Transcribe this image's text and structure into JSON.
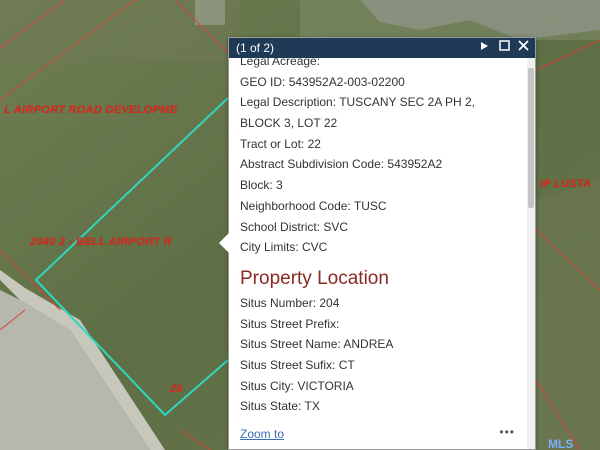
{
  "map": {
    "labels": {
      "road_top": "L AIRPORT ROAD DEVELOPME",
      "road_left": "2040   2 - BELL AIRPORT R",
      "road_bottom": "20 ",
      "right_edge": "IP LUSTA"
    },
    "colors": {
      "parcel_outline": "#2fd6c0",
      "lot_lines": "#d3453a",
      "label_red": "#e0261c"
    }
  },
  "popup": {
    "header": {
      "counter": "(1 of 2)",
      "next_icon": "play-icon",
      "maximize_icon": "maximize-icon",
      "close_icon": "close-icon"
    },
    "attributes": [
      {
        "label": "Legal Acreage:",
        "value": ""
      },
      {
        "label": "GEO ID:",
        "value": "543952A2-003-02200"
      },
      {
        "label": "Legal Description:",
        "value": "TUSCANY SEC 2A PH 2,"
      },
      {
        "label": "",
        "value": "BLOCK 3, LOT 22"
      },
      {
        "label": "Tract or Lot:",
        "value": "22"
      },
      {
        "label": "Abstract Subdivision Code:",
        "value": "543952A2"
      },
      {
        "label": "Block:",
        "value": "3"
      },
      {
        "label": "Neighborhood Code:",
        "value": "TUSC"
      },
      {
        "label": "School District:",
        "value": "SVC"
      },
      {
        "label": "City Limits:",
        "value": "CVC"
      }
    ],
    "section_title": "Property Location",
    "location": [
      {
        "label": "Situs Number:",
        "value": "204"
      },
      {
        "label": "Situs Street Prefix:",
        "value": ""
      },
      {
        "label": "Situs Street Name:",
        "value": "ANDREA"
      },
      {
        "label": "Situs Street Sufix:",
        "value": "CT"
      },
      {
        "label": "Situs City:",
        "value": "VICTORIA"
      },
      {
        "label": "Situs State:",
        "value": "TX"
      }
    ],
    "zoom_to": "Zoom to",
    "more": "•••"
  },
  "watermark": "MLS"
}
